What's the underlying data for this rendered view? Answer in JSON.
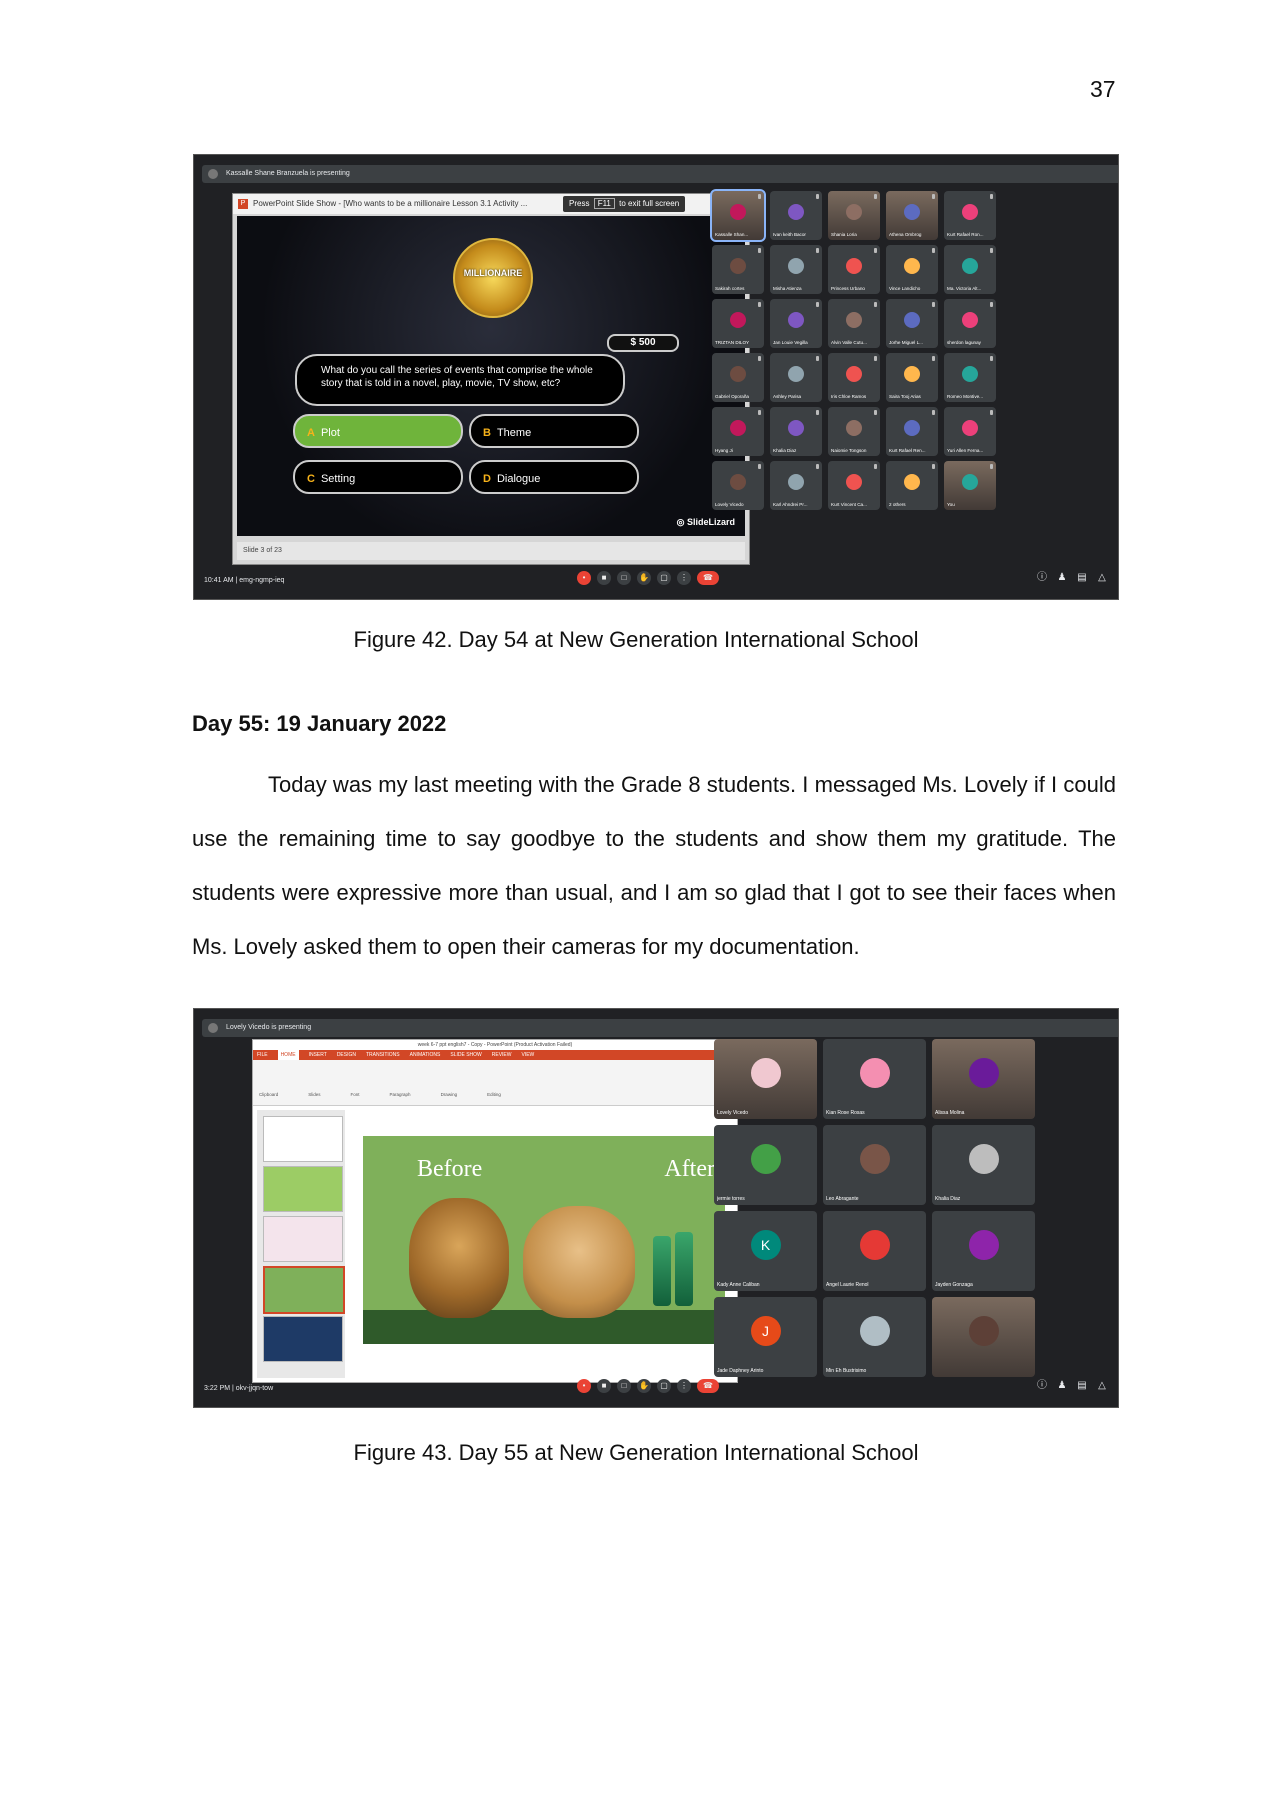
{
  "page_number": "37",
  "figure1": {
    "caption": "Figure 42. Day 54 at New Generation International School",
    "presenting": "Kassalle Shane Branzuela is presenting",
    "window_title": "PowerPoint Slide Show - [Who wants to be a millionaire Lesson 3.1 Activity ...",
    "f11_press": "Press",
    "f11_key": "F11",
    "f11_rest": "to exit full screen",
    "logo_text": "MILLIONAIRE",
    "money": "$ 500",
    "question": "What do you call the series of events that comprise the whole story that is told in a novel, play, movie, TV show, etc?",
    "answers": [
      {
        "key": "A",
        "text": "Plot"
      },
      {
        "key": "B",
        "text": "Theme"
      },
      {
        "key": "C",
        "text": "Setting"
      },
      {
        "key": "D",
        "text": "Dialogue"
      }
    ],
    "brand": "SlideLizard",
    "slide_status": "Slide 3 of 23",
    "meet_info": "10:41 AM  |  emg-ngmp-ieq",
    "participants": [
      "Kassalle Shan...",
      "Ivan keith Bacor",
      "Shania Loria",
      "Athena Ombrog",
      "Kurt Rafael Ron...",
      "Sakirah cortes",
      "Misha Atienza",
      "Princess Urbano",
      "Vince Landicho",
      "Ma. Victoria Alt...",
      "TRIZTAN DILOY",
      "Jan Louie Vegilla",
      "Alvin Valle Cutu...",
      "Jorhe Miguel L...",
      "sherdon lagunay",
      "Gabriel Oporaña",
      "Ashley Parisa",
      "Iris Chloe Ramos",
      "Saira Tooj Arias",
      "Romeo Montive...",
      "Hyang Ji",
      "Khalia Diaz",
      "Naiomie Tongson",
      "Kurt Rafael Ren...",
      "Yuri Allen Ferna...",
      "Lovely Vicedo",
      "Karl Ahndrei Pr...",
      "Kurt Vincent Ca...",
      "2 others",
      "You"
    ]
  },
  "heading": "Day 55: 19 January 2022",
  "paragraph": "Today was my last meeting with the Grade 8 students. I messaged Ms. Lovely if I could use the remaining time to say goodbye to the students and show them my gratitude. The students were expressive more than usual, and I am so glad that I got to see their faces when Ms. Lovely asked them to open their cameras for my documentation.",
  "figure2": {
    "caption": "Figure 43. Day 55 at New Generation International School",
    "presenting": "Lovely Vicedo is presenting",
    "ppt_title": "week 6-7 ppt english7 - Copy - PowerPoint (Product Activation Failed)",
    "menu": [
      "FILE",
      "HOME",
      "INSERT",
      "DESIGN",
      "TRANSITIONS",
      "ANIMATIONS",
      "SLIDE SHOW",
      "REVIEW",
      "VIEW"
    ],
    "ribbon_groups": [
      "Clipboard",
      "Slides",
      "Font",
      "Paragraph",
      "Drawing",
      "Editing"
    ],
    "before": "Before",
    "after": "After",
    "meet_info": "3:22 PM  |  okv-jjqn-tow",
    "participants": [
      {
        "name": "Lovely Vicedo",
        "initial": ""
      },
      {
        "name": "Kian Rose Rosas",
        "initial": ""
      },
      {
        "name": "Alissa Molina",
        "initial": ""
      },
      {
        "name": "jermie torres",
        "initial": ""
      },
      {
        "name": "Leo Abragante",
        "initial": ""
      },
      {
        "name": "Khalia Diaz",
        "initial": ""
      },
      {
        "name": "Kady Anne Caliban",
        "initial": "K"
      },
      {
        "name": "Angel Laurie Renol",
        "initial": ""
      },
      {
        "name": "Jayden Gonzaga",
        "initial": ""
      },
      {
        "name": "Jade Daphney Arinto",
        "initial": "J"
      },
      {
        "name": "Min Eh Bustrisimo",
        "initial": ""
      },
      {
        "name": "",
        "initial": ""
      }
    ]
  }
}
